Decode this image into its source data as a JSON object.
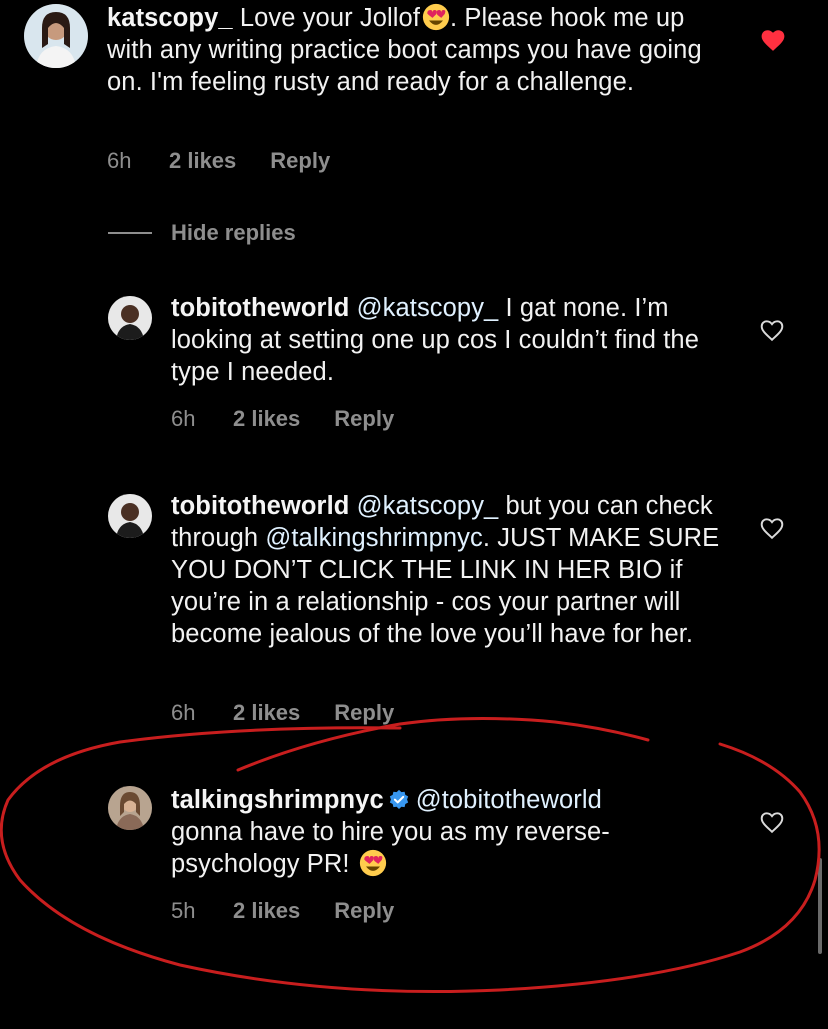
{
  "comments": [
    {
      "username": "katscopy_",
      "text_1": " Love your Jollof",
      "text_2": ". Please hook me up with any writing practice boot camps you have going on. I'm feeling rusty and ready for a challenge.",
      "time": "6h",
      "likes": "2 likes",
      "reply": "Reply",
      "liked": true
    }
  ],
  "hide_replies": "Hide replies",
  "replies": [
    {
      "username": "tobitotheworld",
      "mention": "@katscopy_",
      "text": " I gat none. I’m looking at setting one up cos I couldn’t find the type I needed.",
      "time": "6h",
      "likes": "2 likes",
      "reply": "Reply"
    },
    {
      "username": "tobitotheworld",
      "mention": "@katscopy_",
      "text_a": " but you can check through ",
      "mention_2": "@talkingshrimpnyc",
      "text_b": ". JUST MAKE SURE YOU DON’T CLICK THE LINK IN HER BIO if you’re in a relationship - cos your partner will become jealous of the love you’ll have for her.",
      "time": "6h",
      "likes": "2 likes",
      "reply": "Reply"
    },
    {
      "username": "talkingshrimpnyc",
      "mention": "@tobitotheworld",
      "text": " gonna have to hire you as my reverse-psychology PR! ",
      "time": "5h",
      "likes": "2 likes",
      "reply": "Reply",
      "verified": true
    }
  ],
  "colors": {
    "liked_heart": "#ff3040",
    "annotation": "#c81e1e",
    "verified": "#3897f0",
    "meta": "#8e8e8e"
  },
  "icons": {
    "heart": "heart-icon",
    "heart_filled": "heart-filled-icon",
    "verified": "verified-badge-icon",
    "emoji": "heart-eyes-emoji-icon"
  }
}
